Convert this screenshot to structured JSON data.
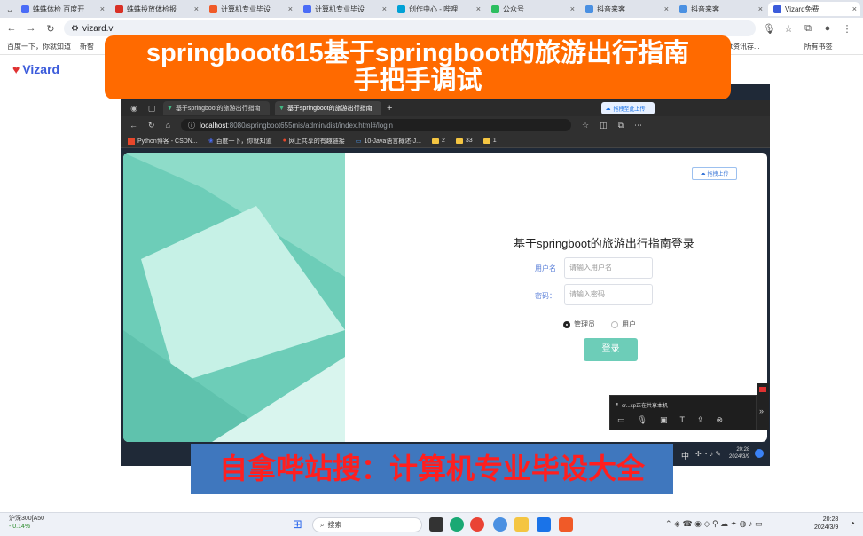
{
  "outer_browser": {
    "tabs": [
      {
        "label": "蛛蛛体检 百度开",
        "color": "#4a6cf7"
      },
      {
        "label": "蛛蛛投放体检报",
        "color": "#d93025"
      },
      {
        "label": "计算机专业毕设",
        "color": "#f05a28"
      },
      {
        "label": "计算机专业毕设",
        "color": "#4a6cf7"
      },
      {
        "label": "创作中心 - 哔哩",
        "color": "#00a1d6"
      },
      {
        "label": "公众号",
        "color": "#2dbe60"
      },
      {
        "label": "抖音来客",
        "color": "#4a90e2"
      },
      {
        "label": "抖音来客",
        "color": "#4a90e2"
      },
      {
        "label": "Vizard免费",
        "color": "#3b5bdb"
      }
    ],
    "url": "vizard.vi",
    "bookmarks": [
      "百度一下，你就知道",
      "新智",
      "ersoft资讯存..."
    ],
    "bookmarks_right": "所有书签",
    "logo": "Vizard"
  },
  "title_banner": {
    "line1": "springboot615基于springboot的旅游出行指南",
    "line2": "手把手调试"
  },
  "inner_browser": {
    "tabs": [
      "基于springboot的旅游出行指南",
      "基于springboot的旅游出行指南"
    ],
    "url_host": "localhost",
    "url_path": ":8080/springboot655mis/admin/dist/index.html#/login",
    "upload_label": "拖拽至此上传",
    "bookmarks": [
      "Python博客 - CSDN...",
      "百度一下，你就知道",
      "网上共享的有趣链接",
      "10-Java语言概述-J...",
      "2",
      "33",
      "1"
    ]
  },
  "login": {
    "title": "基于springboot的旅游出行指南登录",
    "username_label": "用户名",
    "username_placeholder": "请输入用户名",
    "password_label": "密码：",
    "password_placeholder": "请输入密码",
    "role_admin": "管理员",
    "role_user": "用户",
    "submit": "登录",
    "upload": "拖拽上传"
  },
  "inner_taskbar": {
    "ime": "中",
    "time": "20:28",
    "date": "2024/3/9"
  },
  "recorder": {
    "title": "cr...xp正在共享本机"
  },
  "subtitle_banner": {
    "text": "自拿哔站搜：计算机专业毕设大全"
  },
  "win_taskbar": {
    "stock_name": "沪深300[A50",
    "stock_change": "- 0.14%",
    "search": "搜索",
    "time": "20:28",
    "date": "2024/3/9"
  }
}
